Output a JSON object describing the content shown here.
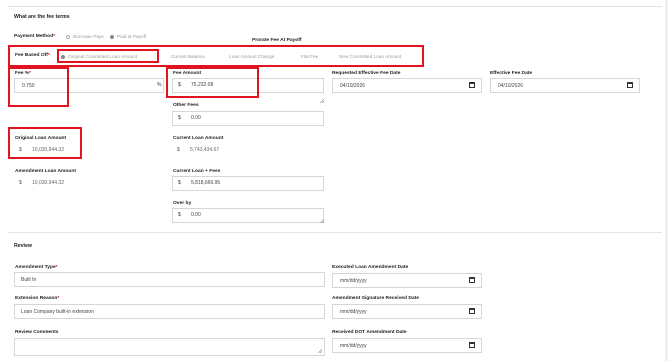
{
  "fee_terms": {
    "title": "What are the fee terms",
    "payment_method": {
      "label": "Payment Method",
      "options": [
        "Borrower Pays",
        "Paid at Payoff"
      ]
    },
    "prorate_title": "Prorate Fee At Payoff",
    "fee_based_off": {
      "label": "Fee Based Off",
      "options": [
        "Original Committed Loan Amount",
        "Current Balance",
        "Loan Amount Change",
        "Flat Fee",
        "New Committed Loan Amount"
      ],
      "selected": "Original Committed Loan Amount"
    },
    "fee_pct": {
      "label": "Fee %",
      "value": "0.750",
      "suffix": "%"
    },
    "fee_amount": {
      "label": "Fee Amount",
      "currency": "$",
      "value": "75,232.08"
    },
    "requested_effective_fee_date": {
      "label": "Requested Effective Fee Date",
      "value": "04/10/2026"
    },
    "effective_fee_date": {
      "label": "Effective Fee Date",
      "value": "04/10/2026"
    },
    "other_fees": {
      "label": "Other Fees",
      "currency": "$",
      "value": "0.00"
    },
    "original_loan_amount": {
      "label": "Original Loan Amount",
      "currency": "$",
      "value": "10,030,944.32"
    },
    "current_loan_amount": {
      "label": "Current Loan Amount",
      "currency": "$",
      "value": "5,743,434.67"
    },
    "amendment_loan_amount": {
      "label": "Amendment Loan Amount",
      "currency": "$",
      "value": "10,030,944.32"
    },
    "current_loan_fees": {
      "label": "Current Loan + Fees",
      "currency": "$",
      "value": "5,818,666.95"
    },
    "over_by": {
      "label": "Over by",
      "currency": "$",
      "value": "0.00"
    }
  },
  "review": {
    "title": "Review",
    "amendment_type": {
      "label": "Amendment Type",
      "value": "Built In"
    },
    "executed_loan_amendment_date": {
      "label": "Executed Loan Amendment Date",
      "placeholder": "mm/dd/yyyy"
    },
    "extension_reason": {
      "label": "Extension Reason",
      "placeholder": "Loan Company built-in extension"
    },
    "amendment_signature_received_date": {
      "label": "Amendment Signature Received Date",
      "placeholder": "mm/dd/yyyy"
    },
    "review_comments": {
      "label": "Review Comments",
      "value": ""
    },
    "received_dot_amendment_date": {
      "label": "Received DOT Amendment Date",
      "placeholder": "mm/dd/yyyy"
    }
  },
  "icons": {
    "calendar": "calendar-icon",
    "resize": "resize-grip-icon"
  },
  "colors": {
    "highlight": "#e0141e",
    "required": "#d0021b"
  }
}
